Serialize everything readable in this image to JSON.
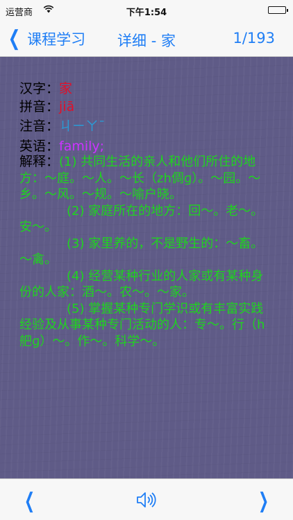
{
  "status": {
    "carrier": "运营商",
    "time": "下午1:54"
  },
  "nav": {
    "back_label": "课程学习",
    "title": "详细 - 家",
    "count": "1/193"
  },
  "entry": {
    "hanzi_key": "汉字：",
    "hanzi": "家",
    "pinyin_key": "拼音：",
    "pinyin": "jiā",
    "zhuyin_key": "注音：",
    "zhuyin": "ㄐㄧㄚˉ",
    "english_key": "英语：",
    "english": "family;",
    "explain_key": "解释：",
    "explanations": [
      "(1) 共同生活的亲人和他们所住的地方：～庭。～人。～长（zh倜ɡ）。～园。～乡。～风。～规。～喻户晓。",
      "(2) 家庭所在的地方：回～。老～。安～。",
      "(3) 家里养的，不是野生的：～畜。～禽。",
      "(4) 经营某种行业的人家或有某种身份的人家：酒～。农～。～家。",
      "(5) 掌握某种专门学识或有丰富实践经验及从事某种专门活动的人：专～。行（h舥ɡ）～。作～。科学～。"
    ]
  },
  "colors": {
    "accent": "#1f7ef5",
    "background": "#5f5b87",
    "hanzi": "#e0102a",
    "zhuyin": "#2a9bd6",
    "english": "#cc33ff",
    "explain": "#1fd41f"
  },
  "icons": {
    "prev": "chevron-left-icon",
    "audio": "speaker-icon",
    "next": "chevron-right-icon"
  }
}
